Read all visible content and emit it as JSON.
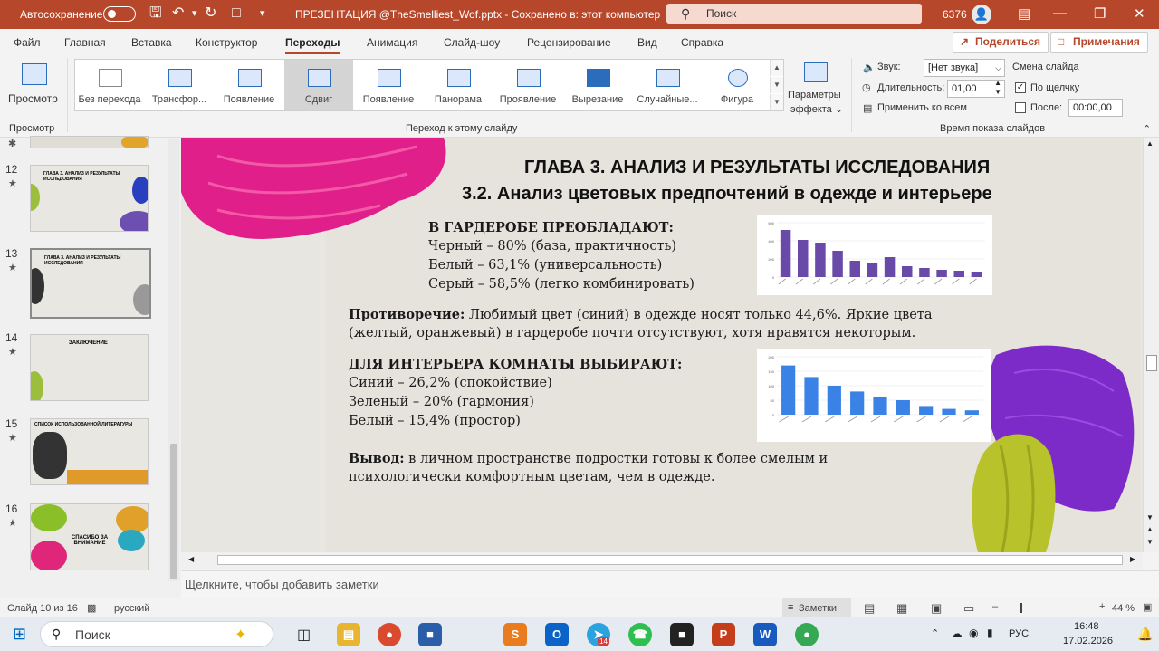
{
  "titlebar": {
    "autosave_label": "Автосохранение",
    "file_title": "ПРЕЗЕНТАЦИЯ @TheSmelliest_Wof.pptx  -  Сохранено в: этот компьютер  ⌄",
    "search_placeholder": "Поиск",
    "account_number": "6376"
  },
  "menu_tabs": [
    "Файл",
    "Главная",
    "Вставка",
    "Конструктор",
    "Переходы",
    "Анимация",
    "Слайд-шоу",
    "Рецензирование",
    "Вид",
    "Справка"
  ],
  "share_button": "Поделиться",
  "comments_button": "Примечания",
  "ribbon": {
    "preview_label": "Просмотр",
    "preview_group": "Просмотр",
    "transitions": [
      "Без перехода",
      "Трансфор...",
      "Появление",
      "Сдвиг",
      "Появление",
      "Панорама",
      "Проявление",
      "Вырезание",
      "Случайные...",
      "Фигура"
    ],
    "selected_transition": "Сдвиг",
    "effect_params_1": "Параметры",
    "effect_params_2": "эффекта ⌄",
    "transition_group": "Переход к этому слайду",
    "sound_label": "Звук:",
    "sound_value": "[Нет звука]",
    "duration_label": "Длительность:",
    "duration_value": "01,00",
    "apply_all": "Применить ко всем",
    "advance_title": "Смена слайда",
    "on_click": "По щелчку",
    "after_label": "После:",
    "after_value": "00:00,00",
    "timing_group": "Время показа слайдов"
  },
  "thumbnails": [
    {
      "num": "12",
      "star": "★",
      "title": "ГЛАВА 3. АНАЛИЗ И РЕЗУЛЬТАТЫ ИССЛЕДОВАНИЯ"
    },
    {
      "num": "13",
      "star": "★",
      "title": "ГЛАВА 3. АНАЛИЗ И РЕЗУЛЬТАТЫ ИССЛЕДОВАНИЯ"
    },
    {
      "num": "14",
      "star": "★",
      "title": "ЗАКЛЮЧЕНИЕ"
    },
    {
      "num": "15",
      "star": "★",
      "title": "СПИСОК ИСПОЛЬЗОВАННОЙ ЛИТЕРАТУРЫ"
    },
    {
      "num": "16",
      "star": "★",
      "title": "СПАСИБО ЗА ВНИМАНИЕ"
    }
  ],
  "slide": {
    "title1": "ГЛАВА 3. АНАЛИЗ И РЕЗУЛЬТАТЫ ИССЛЕДОВАНИЯ",
    "title2": "3.2. Анализ цветовых предпочтений в одежде и интерьере",
    "wardrobe_heading": "В ГАРДЕРОБЕ ПРЕОБЛАДАЮТ:",
    "wardrobe_items": [
      "Черный – 80% (база, практичность)",
      "Белый – 63,1% (универсальность)",
      "Серый – 58,5% (легко комбинировать)"
    ],
    "contradiction_label": "Противоречие:",
    "contradiction_text1": " Любимый цвет (синий) в одежде носят только 44,6%. Яркие цвета",
    "contradiction_text2": "(желтый, оранжевый) в гардеробе почти отсутствуют, хотя нравятся некоторым.",
    "interior_heading": "ДЛЯ ИНТЕРЬЕРА КОМНАТЫ ВЫБИРАЮТ:",
    "interior_items": [
      "Синий – 26,2% (спокойствие)",
      "Зеленый – 20% (гармония)",
      "Белый – 15,4% (простор)"
    ],
    "conclusion_label": "Вывод:",
    "conclusion_text1": " в личном пространстве подростки готовы к более смелым и",
    "conclusion_text2": "психологически комфортным цветам, чем в одежде."
  },
  "chart_data": [
    {
      "type": "bar",
      "color": "#6a4aa8",
      "yticks": [
        "600",
        "400",
        "200",
        "0"
      ],
      "ylim": [
        0,
        600
      ],
      "values": [
        520,
        410,
        380,
        290,
        180,
        160,
        220,
        120,
        100,
        80,
        70,
        60
      ]
    },
    {
      "type": "bar",
      "color": "#3b82e6",
      "yticks": [
        "200",
        "150",
        "100",
        "50",
        "0"
      ],
      "ylim": [
        0,
        200
      ],
      "values": [
        170,
        130,
        100,
        80,
        60,
        50,
        30,
        20,
        15
      ]
    }
  ],
  "notes_placeholder": "Щелкните, чтобы добавить заметки",
  "status": {
    "slide_info": "Слайд 10 из 16",
    "language": "русский",
    "notes_btn": "Заметки",
    "zoom": "44 %"
  },
  "taskbar": {
    "search": "Поиск",
    "lang": "РУС",
    "time": "16:48",
    "date": "17.02.2026",
    "telegram_badge": "14"
  }
}
